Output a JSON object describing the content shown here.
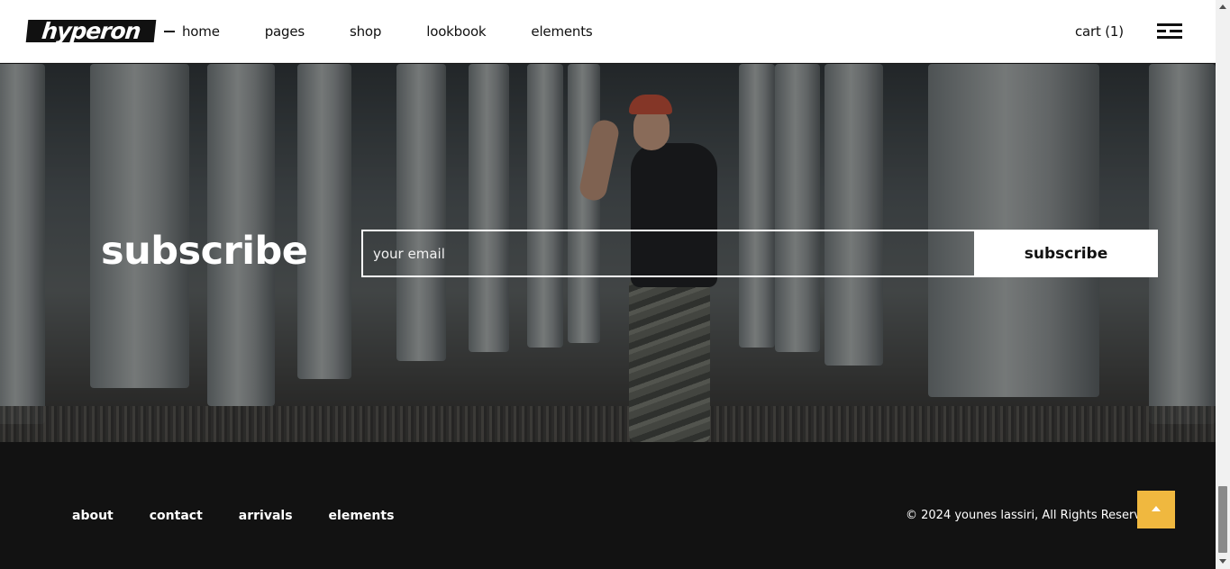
{
  "header": {
    "logo": "hyperon",
    "nav": [
      "home",
      "pages",
      "shop",
      "lookbook",
      "elements"
    ],
    "cart": "cart (1)",
    "menu_icon": "hamburger-menu-icon"
  },
  "subscribe": {
    "title": "subscribe",
    "placeholder": "your email",
    "button": "subscribe"
  },
  "footer": {
    "links": [
      "about",
      "contact",
      "arrivals",
      "elements"
    ],
    "copyright": "© 2024 younes lassiri, All Rights Reserved",
    "top_button_icon": "arrow-up-icon",
    "top_button_color": "#f0b83f"
  }
}
